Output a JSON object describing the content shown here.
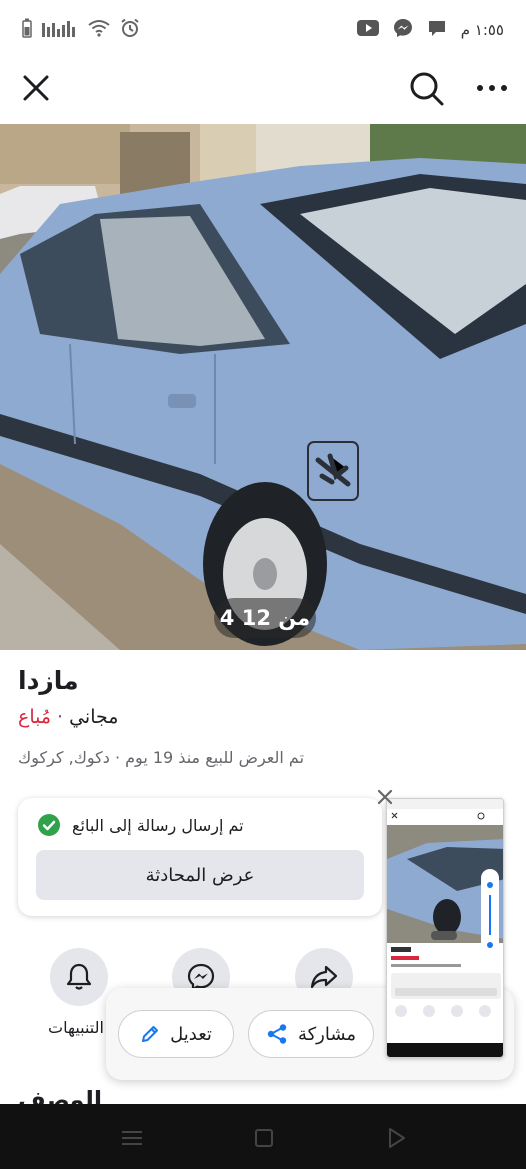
{
  "status_bar": {
    "time": "١:٥٥ م"
  },
  "top_bar": {
    "close_icon": "close-icon",
    "search_icon": "search-icon",
    "more_icon": "more-icon"
  },
  "photo": {
    "counter": "4 من 12"
  },
  "listing": {
    "title": "مازدا",
    "status": "مُباع",
    "separator": "·",
    "price": "مجاني",
    "meta": "تم العرض للبيع منذ 19 يوم · دكوك, كركوك"
  },
  "message_card": {
    "text": "تم إرسال رسالة إلى البائع",
    "button_label": "عرض المحادثة"
  },
  "actions": {
    "alerts_label": "التنبيهات"
  },
  "float_panel": {
    "share_label": "مشاركة",
    "edit_label": "تعديل"
  },
  "description": {
    "heading": "الوصف"
  },
  "colors": {
    "sold_red": "#d8283d",
    "check_green": "#31a24c",
    "accent_blue": "#1877f2"
  }
}
